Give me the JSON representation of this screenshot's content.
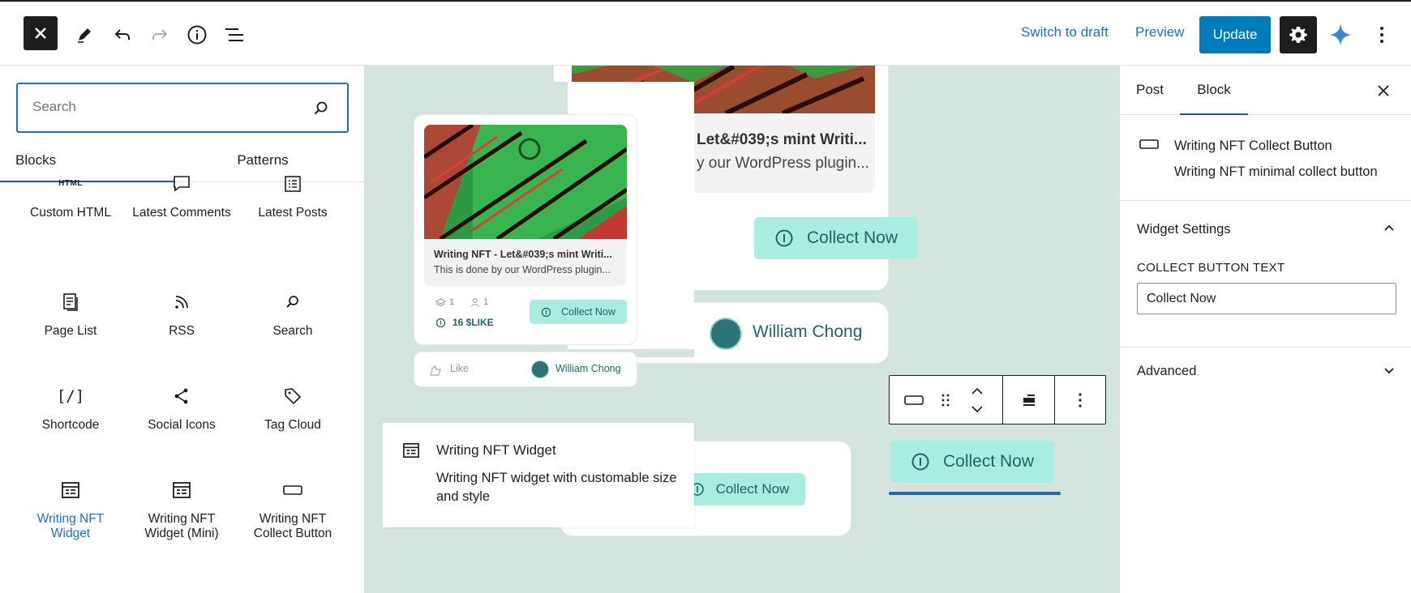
{
  "toolbar": {
    "switch_to_draft": "Switch to draft",
    "preview": "Preview",
    "update": "Update"
  },
  "inserter": {
    "search_placeholder": "Search",
    "tabs": [
      "Blocks",
      "Patterns"
    ],
    "blocks": [
      {
        "label": "Custom HTML",
        "icon": "html-icon",
        "icon_text": "HTML"
      },
      {
        "label": "Latest Comments",
        "icon": "comment-icon"
      },
      {
        "label": "Latest Posts",
        "icon": "post-list-icon"
      },
      {
        "label": "Page List",
        "icon": "pages-icon"
      },
      {
        "label": "RSS",
        "icon": "rss-icon"
      },
      {
        "label": "Search",
        "icon": "search-icon"
      },
      {
        "label": "Shortcode",
        "icon": "shortcode-icon",
        "icon_text": "[/]"
      },
      {
        "label": "Social Icons",
        "icon": "share-icon"
      },
      {
        "label": "Tag Cloud",
        "icon": "tag-icon"
      },
      {
        "label": "Writing NFT Widget",
        "icon": "widget-icon"
      },
      {
        "label": "Writing NFT Widget (Mini)",
        "icon": "widget-icon"
      },
      {
        "label": "Writing NFT Collect Button",
        "icon": "button-icon"
      }
    ]
  },
  "canvas": {
    "big_card": {
      "title": "Let&#039;s mint Writi...",
      "description": "y our WordPress plugin...",
      "collect_label": "Collect Now",
      "author": "William Chong"
    },
    "mini_card": {
      "title": "Writing NFT - Let&#039;s mint Writi...",
      "description": "This is done by our WordPress plugin...",
      "layers_count": "1",
      "owners_count": "1",
      "price": "16 $LIKE",
      "collect_label": "Collect Now",
      "like_label": "Like",
      "author": "William Chong"
    },
    "block_preview": {
      "title": "Writing NFT Widget",
      "description": "Writing NFT widget with customable size and style"
    },
    "lower_card": {
      "collect_label": "Collect Now"
    },
    "selected_button": {
      "collect_label": "Collect Now"
    },
    "colors": {
      "accent": "#a9ede0",
      "accent_text": "#1d6663",
      "canvas_bg": "#d3e4de"
    }
  },
  "sidebar": {
    "tabs": [
      "Post",
      "Block"
    ],
    "block_name": "Writing NFT Collect Button",
    "block_description": "Writing NFT minimal collect button",
    "widget_settings_title": "Widget Settings",
    "collect_button_text_label": "COLLECT BUTTON TEXT",
    "collect_button_text_value": "Collect Now",
    "advanced_title": "Advanced"
  },
  "colors": {
    "wp_blue": "#2271b1",
    "primary": "#007cba",
    "dark": "#1e1e1e"
  }
}
